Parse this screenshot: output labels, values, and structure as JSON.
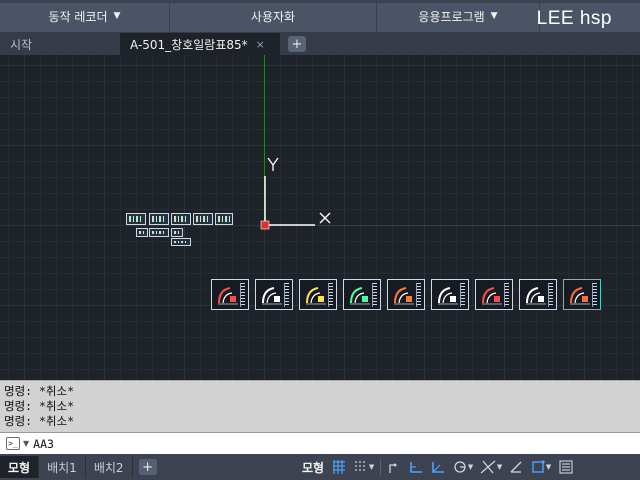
{
  "ribbon": {
    "panels": [
      {
        "label": "동작 레코더",
        "has_dropdown": true
      },
      {
        "label": "사용자화",
        "has_dropdown": false
      },
      {
        "label": "응용프로그램",
        "has_dropdown": true
      },
      {
        "label": "",
        "has_dropdown": false
      }
    ],
    "watermark": "LEE hsp"
  },
  "tabs": {
    "items": [
      {
        "label": "시작",
        "active": false
      },
      {
        "label": "A-501_창호일람표85*",
        "active": true
      }
    ],
    "close_icon": "×",
    "add_icon": "+"
  },
  "viewport": {
    "ucs_y_label": "Y",
    "ucs_x_label": "X",
    "axis_colors": {
      "y": "#2f7a35",
      "x": "#7a2525",
      "origin": "#e0302a"
    },
    "sheet_count": 9,
    "selected_sheet_index": 8
  },
  "command": {
    "history": [
      "명령: *취소*",
      "명령: *취소*",
      "명령: *취소*"
    ],
    "prompt_icon": ">_",
    "input_value": "AA3"
  },
  "status": {
    "layout_tabs": [
      {
        "label": "모형",
        "active": true
      },
      {
        "label": "배치1",
        "active": false
      },
      {
        "label": "배치2",
        "active": false
      }
    ],
    "add_layout": "+",
    "model_space_label": "모형",
    "accent": "#4aa3ff"
  }
}
